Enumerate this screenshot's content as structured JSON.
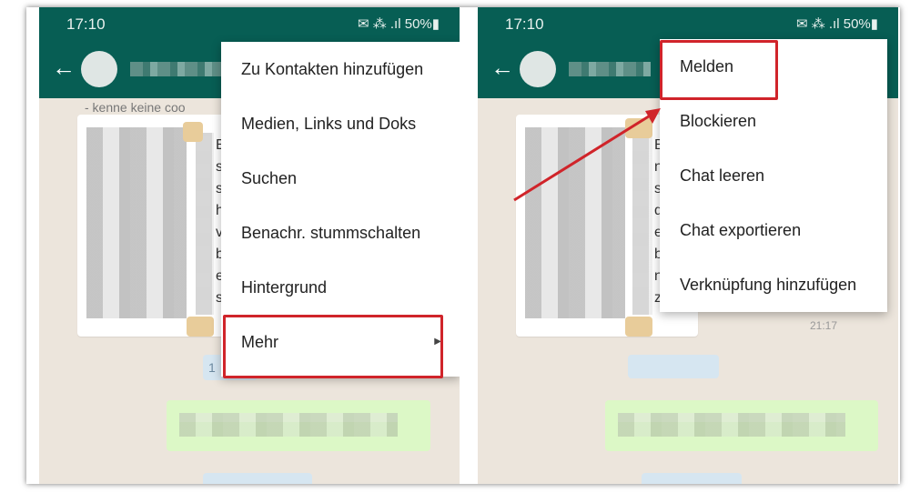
{
  "status": {
    "time": "17:10",
    "icons_text": "✉ ⁂ .ıl 50%▮"
  },
  "left_menu": {
    "items": [
      "Zu Kontakten hinzufügen",
      "Medien, Links und Doks",
      "Suchen",
      "Benachr. stummschalten",
      "Hintergrund",
      "Mehr"
    ]
  },
  "right_menu": {
    "items": [
      "Melden",
      "Blockieren",
      "Chat leeren",
      "Chat exportieren",
      "Verknüpfung hinzufügen"
    ]
  },
  "chat": {
    "left_top_text": "- kenne keine coo",
    "left_fragments": [
      "E",
      "st (",
      "ssi",
      "h c",
      "ver",
      "be",
      "enr",
      "s z"
    ],
    "right_fragments": [
      "Be",
      "n",
      "sie",
      "di",
      "err",
      "bei",
      "nn",
      "zu"
    ],
    "right_timestamp": "21:17",
    "left_blur_label": "1"
  },
  "colors": {
    "header": "#075e54",
    "highlight": "#d0242a",
    "chat_bg": "#ece5dc",
    "outgoing_bubble": "#dcf8c6"
  }
}
